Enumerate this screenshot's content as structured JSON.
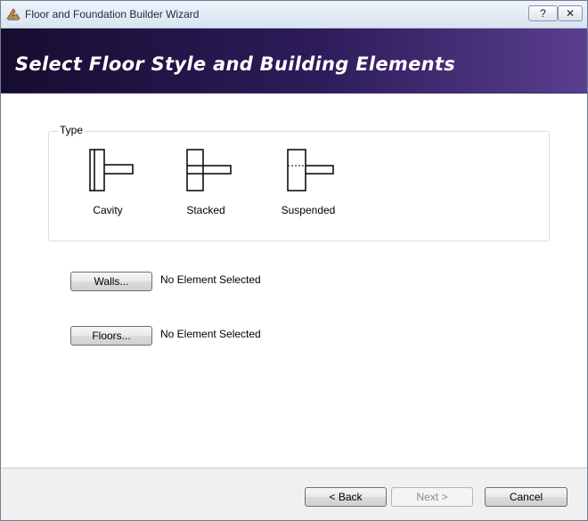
{
  "window": {
    "title": "Floor and Foundation Builder Wizard",
    "help_label": "?",
    "close_label": "✕"
  },
  "banner": {
    "title": "Select Floor Style and Building Elements"
  },
  "type_group": {
    "legend": "Type",
    "options": [
      {
        "label": "Cavity",
        "icon": "cavity-floor-icon"
      },
      {
        "label": "Stacked",
        "icon": "stacked-floor-icon"
      },
      {
        "label": "Suspended",
        "icon": "suspended-floor-icon"
      }
    ]
  },
  "walls": {
    "button_label": "Walls...",
    "status": "No Element Selected"
  },
  "floors": {
    "button_label": "Floors...",
    "status": "No Element Selected"
  },
  "footer": {
    "back_label": "< Back",
    "next_label": "Next >",
    "cancel_label": "Cancel"
  }
}
